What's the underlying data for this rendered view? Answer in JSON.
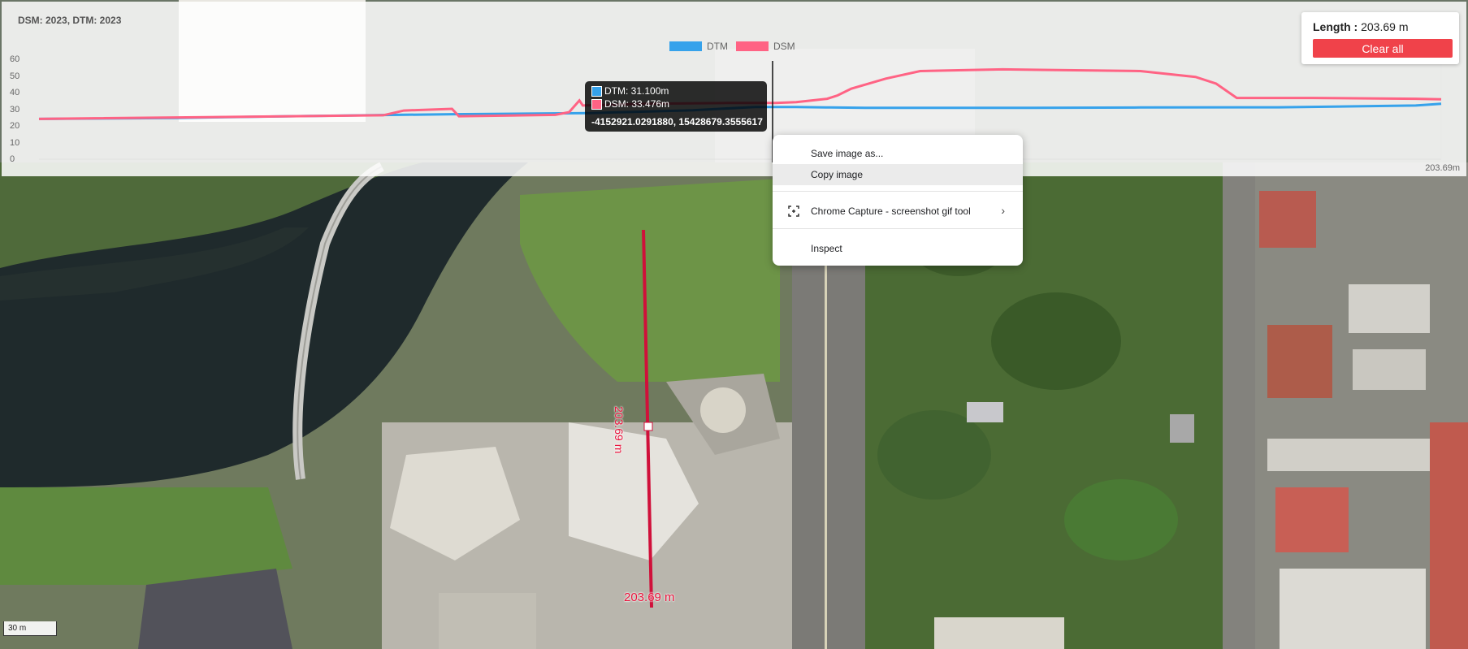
{
  "profile": {
    "title": "DSM: 2023, DTM: 2023",
    "legend": [
      {
        "name": "DTM",
        "color": "#36a2eb"
      },
      {
        "name": "DSM",
        "color": "#ff6384"
      }
    ],
    "y_ticks": [
      "60",
      "50",
      "40",
      "30",
      "20",
      "10",
      "0"
    ],
    "end_distance_label": "203.69m"
  },
  "chart_data": {
    "type": "line",
    "xlabel": "",
    "ylabel": "",
    "ylim": [
      0,
      60
    ],
    "xlim": [
      0,
      203.69
    ],
    "series": [
      {
        "name": "DTM",
        "color": "#36a2eb",
        "x": [
          0,
          20,
          40,
          60,
          80,
          95,
          104,
          110,
          115,
          120,
          140,
          160,
          180,
          200,
          203.69
        ],
        "y": [
          24,
          24.6,
          25.8,
          26.8,
          27.5,
          29.2,
          31.1,
          31.1,
          30.8,
          30.6,
          30.6,
          30.8,
          30.9,
          32,
          33
        ]
      },
      {
        "name": "DSM",
        "color": "#ff6384",
        "x": [
          0,
          50,
          53,
          60,
          61,
          75,
          77,
          78.5,
          79,
          88,
          100,
          104,
          107,
          110,
          114.5,
          116,
          118,
          123,
          128,
          140,
          160,
          168,
          171,
          174,
          185,
          200,
          203.69
        ],
        "y": [
          24,
          26.2,
          29,
          30,
          25.6,
          26.4,
          28,
          35,
          32,
          33,
          33.5,
          33.476,
          33.5,
          34,
          36,
          38,
          42,
          48,
          52.5,
          53.5,
          52.5,
          49,
          45,
          36.5,
          36.5,
          36,
          35.7
        ]
      }
    ]
  },
  "tooltip": {
    "dtm": "DTM: 31.100m",
    "dsm": "DSM: 33.476m",
    "coords": "-4152921.0291880, 15428679.3555617"
  },
  "measure": {
    "length_label": "Length :",
    "length_value": "203.69 m",
    "clear_label": "Clear all",
    "line_label": "203.69 m"
  },
  "context_menu": {
    "items": [
      {
        "label": "Save image as..."
      },
      {
        "label": "Copy image"
      },
      {
        "label": "Chrome Capture - screenshot  gif tool"
      },
      {
        "label": "Inspect"
      }
    ]
  },
  "scale": {
    "label": "30 m"
  }
}
